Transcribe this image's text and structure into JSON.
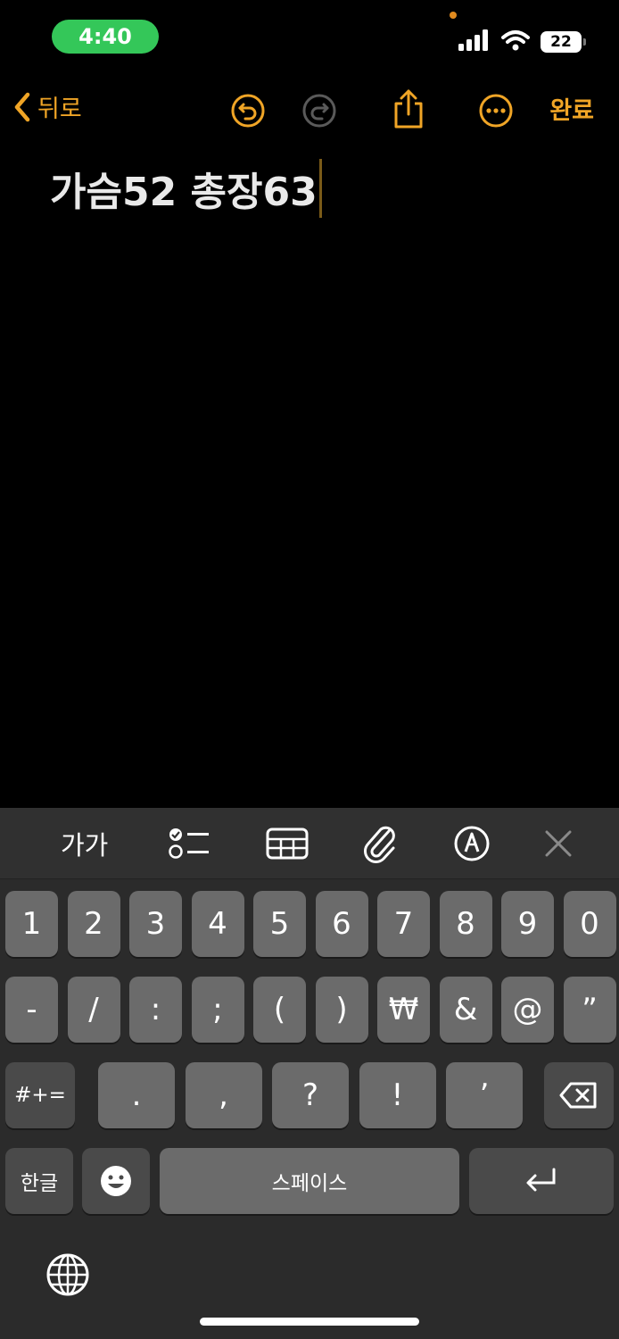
{
  "status": {
    "time": "4:40",
    "battery": "22"
  },
  "nav": {
    "back_label": "뒤로",
    "done_label": "완료"
  },
  "note": {
    "text": "가슴52 총장63"
  },
  "toolbar": {
    "format_label": "가가"
  },
  "keyboard": {
    "row1": [
      "1",
      "2",
      "3",
      "4",
      "5",
      "6",
      "7",
      "8",
      "9",
      "0"
    ],
    "row2": [
      "-",
      "/",
      ":",
      ";",
      "(",
      ")",
      "₩",
      "&",
      "@",
      "”"
    ],
    "row3_mode": "#+=",
    "row3": [
      ".",
      ",",
      "?",
      "!",
      "’"
    ],
    "hangul_label": "한글",
    "space_label": "스페이스"
  },
  "colors": {
    "accent": "#f0a526",
    "status_pill": "#34c759",
    "key": "#6b6b6b",
    "key_dark": "#4a4a4a",
    "keyboard_bg": "#2b2b2b"
  }
}
